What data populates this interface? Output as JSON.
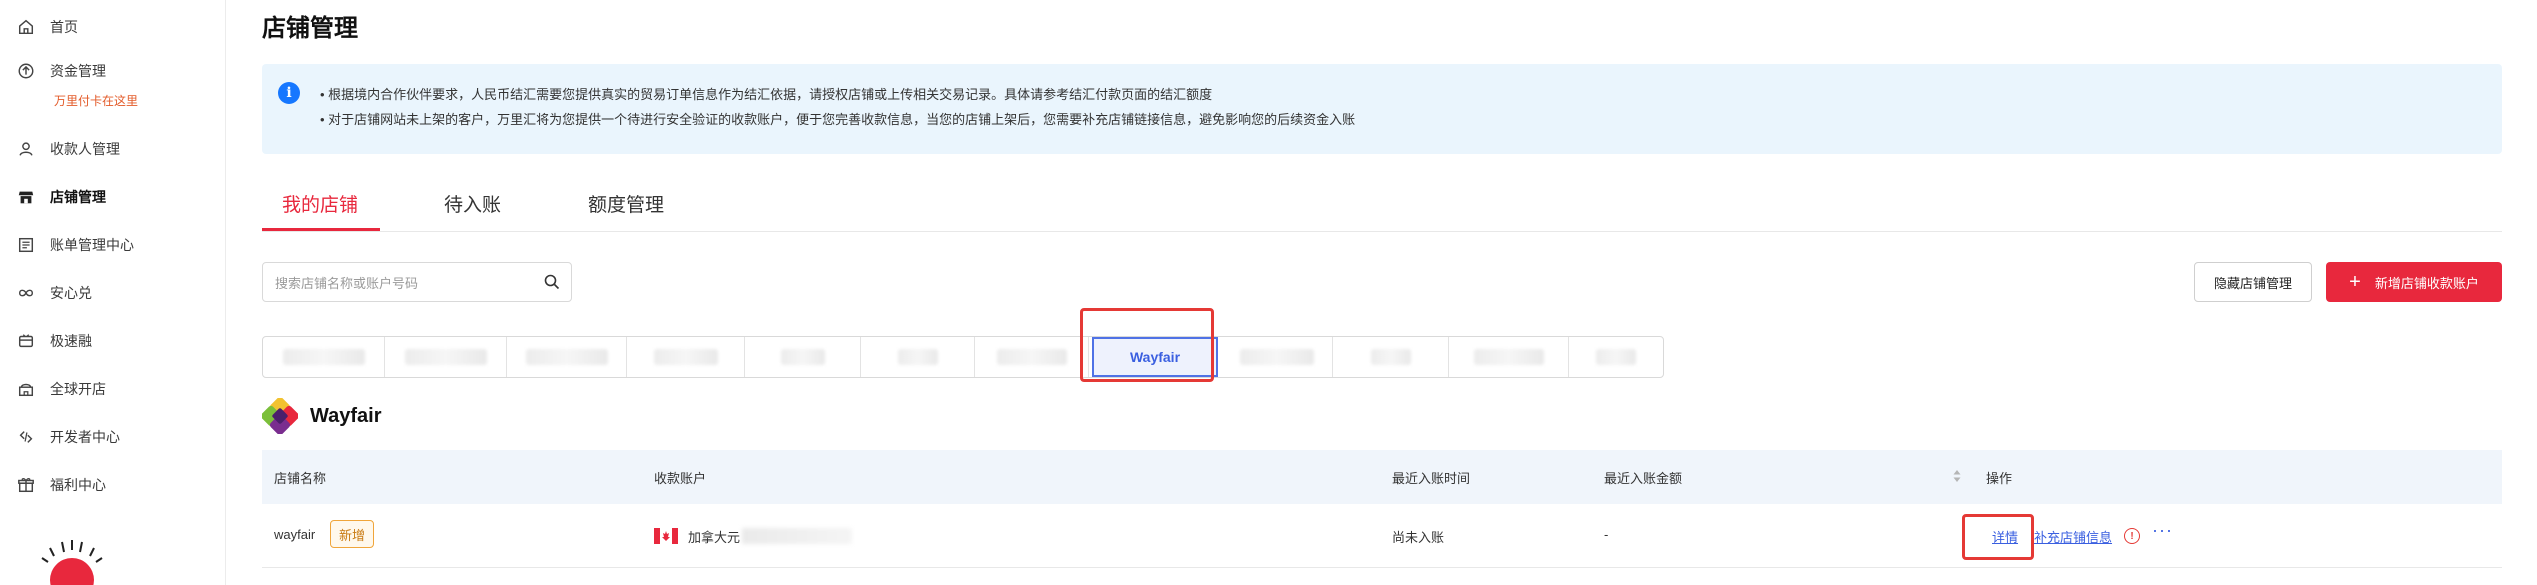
{
  "sidebar": {
    "items": [
      {
        "label": "首页",
        "icon": "home-icon"
      },
      {
        "label": "资金管理",
        "icon": "fund-icon"
      },
      {
        "label": "收款人管理",
        "icon": "payee-icon"
      },
      {
        "label": "店铺管理",
        "icon": "store-icon"
      },
      {
        "label": "账单管理中心",
        "icon": "bill-icon"
      },
      {
        "label": "安心兑",
        "icon": "exchange-icon"
      },
      {
        "label": "极速融",
        "icon": "finance-icon"
      },
      {
        "label": "全球开店",
        "icon": "global-store-icon"
      },
      {
        "label": "开发者中心",
        "icon": "developer-icon"
      },
      {
        "label": "福利中心",
        "icon": "gift-icon"
      }
    ],
    "fund_sub": "万里付卡在这里",
    "active_item": "店铺管理"
  },
  "page": {
    "title": "店铺管理"
  },
  "notice": {
    "line1": "• 根据境内合作伙伴要求，人民币结汇需要您提供真实的贸易订单信息作为结汇依据，请授权店铺或上传相关交易记录。具体请参考结汇付款页面的结汇额度",
    "line2": "• 对于店铺网站未上架的客户，万里汇将为您提供一个待进行安全验证的收款账户，便于您完善收款信息，当您的店铺上架后，您需要补充店铺链接信息，避免影响您的后续资金入账"
  },
  "tabs": [
    {
      "label": "我的店铺",
      "active": true
    },
    {
      "label": "待入账",
      "active": false
    },
    {
      "label": "额度管理",
      "active": false
    }
  ],
  "search": {
    "placeholder": "搜索店铺名称或账户号码"
  },
  "buttons": {
    "hide_store": "隐藏店铺管理",
    "add_account": "新增店铺收款账户"
  },
  "store_tabs": {
    "selected": "Wayfair"
  },
  "brand": {
    "name": "Wayfair"
  },
  "table": {
    "headers": [
      "店铺名称",
      "收款账户",
      "最近入账时间",
      "最近入账金额",
      "操作"
    ],
    "rows": [
      {
        "store_name": "wayfair",
        "badge": "新增",
        "account": "加拿大元",
        "last_time": "尚未入账",
        "last_amount": "-",
        "action_detail": "详情",
        "action_supplement": "补充店铺信息"
      }
    ]
  },
  "colors": {
    "accent_red": "#e8283d",
    "link_blue": "#3a5fe0",
    "notice_bg": "#eaf5fd",
    "table_header_bg": "#f0f5fb"
  }
}
